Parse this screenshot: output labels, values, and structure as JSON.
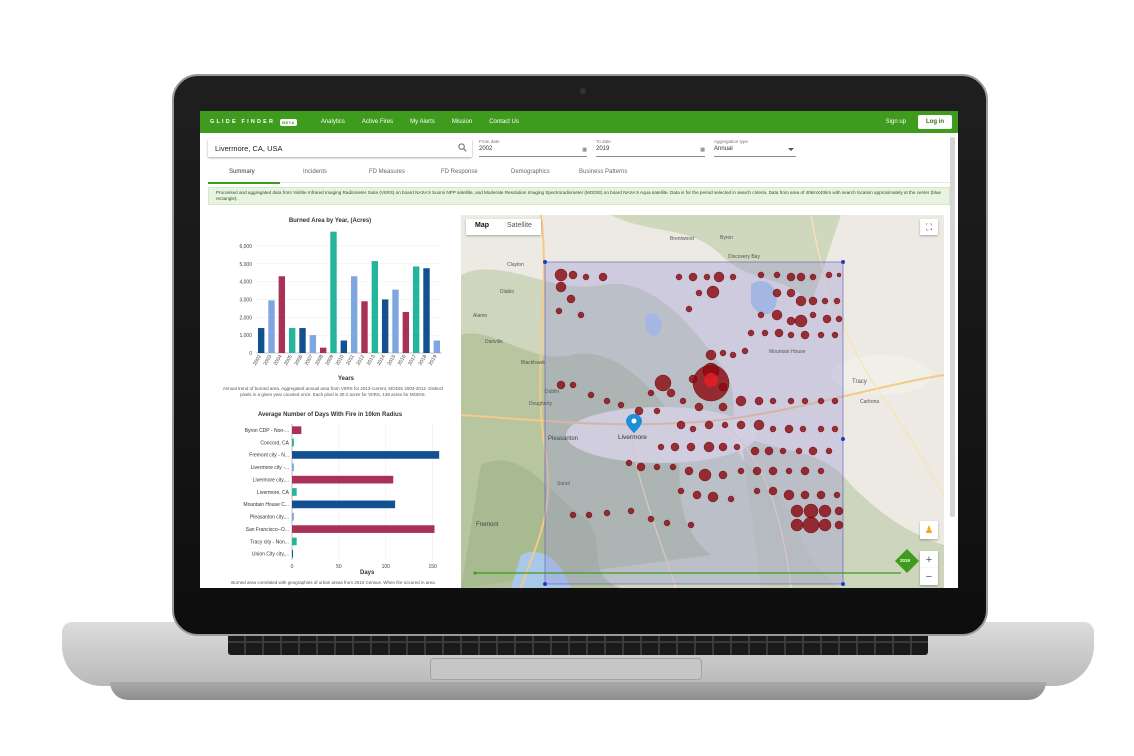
{
  "app": {
    "brand": "GLIDE FINDER",
    "badge": "BETA",
    "nav": [
      "Analytics",
      "Active Fires",
      "My Alerts",
      "Mission",
      "Contact Us"
    ],
    "signup": "Sign up",
    "login": "Log in"
  },
  "search": {
    "value": "Livermore, CA, USA"
  },
  "filters": {
    "from_label": "From date",
    "from_value": "2002",
    "to_label": "To date",
    "to_value": "2019",
    "agg_label": "Aggregation type",
    "agg_value": "Annual"
  },
  "tabs": [
    "Summary",
    "Incidents",
    "FD Measures",
    "FD Response",
    "Demographics",
    "Business Patterns"
  ],
  "info_text": "Processed and aggregated data from Visible Infrared Imaging Radiometer Suite (VIIRS) on board NASA's Suomi NPP satellite, and Moderate Resolution Imaging Spectroradiometer (MODIS) on board NASA's Aqua satellite. Data is for the period selected in search criteria. Data from area of 40kmX40km with search location approximately at the center (blue rectangle).",
  "colors": {
    "brand": "#3f9b1e",
    "teal": "#24b59a",
    "maroon": "#a83155",
    "blue": "#13508f",
    "light_blue": "#7fa6e0",
    "fire": "#8b0a10"
  },
  "chart_data": [
    {
      "type": "bar",
      "title": "Burned Area by Year, (Acres)",
      "xlabel": "Years",
      "ylabel": "",
      "ylim": [
        0,
        6500
      ],
      "yticks": [
        "0",
        "1,000",
        "2,000",
        "3,000",
        "4,000",
        "5,000",
        "6,000"
      ],
      "categories": [
        "2002",
        "2003",
        "2004",
        "2005",
        "2006",
        "2007",
        "2008",
        "2009",
        "2010",
        "2011",
        "2012",
        "2013",
        "2014",
        "2015",
        "2016",
        "2017",
        "2018",
        "2019"
      ],
      "values": [
        1400,
        2950,
        4300,
        1400,
        1400,
        1000,
        300,
        6800,
        700,
        4300,
        2900,
        5150,
        3000,
        3550,
        2300,
        4850,
        4750,
        700
      ],
      "bar_colors": [
        "blue",
        "light_blue",
        "maroon",
        "teal",
        "blue",
        "light_blue",
        "maroon",
        "teal",
        "blue",
        "light_blue",
        "maroon",
        "teal",
        "blue",
        "light_blue",
        "maroon",
        "teal",
        "blue",
        "light_blue"
      ],
      "caption": "Annual trend of burned area. Aggregated annual area from VIIRS for 2013-current, MODIS 2003-2012. Distinct pixels in a given year counted once. Each pixel is 30.2 acres for VIIRS, 139 acres for MODIS."
    },
    {
      "type": "bar",
      "orientation": "horizontal",
      "title": "Average Number of Days With Fire in 10km Radius",
      "xlabel": "Days",
      "ylabel": "",
      "xlim": [
        0,
        160
      ],
      "xticks": [
        "0",
        "50",
        "100",
        "150"
      ],
      "categories": [
        "Byron CDP - Non-...",
        "Concord, CA",
        "Fremont city - N...",
        "Livermore city -...",
        "Livermore city,...",
        "Livermore, CA",
        "Mountain House C...",
        "Pleasanton city,...",
        "San Francisco--O...",
        "Tracy city - Non...",
        "Union City city,..."
      ],
      "values": [
        10,
        2,
        157,
        2,
        108,
        5,
        110,
        2,
        152,
        5,
        1
      ],
      "bar_colors": [
        "maroon",
        "teal",
        "blue",
        "light_blue",
        "maroon",
        "teal",
        "blue",
        "light_blue",
        "maroon",
        "teal",
        "blue"
      ],
      "caption": "Burned area correlated with geographies of urban areas from 2010 Census. When fire occured in area"
    }
  ],
  "map": {
    "type_map": "Map",
    "type_satellite": "Satellite",
    "slider_value": "2019",
    "zoom_in": "+",
    "zoom_out": "−",
    "place_labels": [
      "Brentwood",
      "Discovery Bay",
      "Byron",
      "Mountain House",
      "Tracy",
      "Carbona",
      "Livermore",
      "Pleasanton",
      "Dublin",
      "Dougherty",
      "Fremont",
      "Clayton",
      "Diablo",
      "Alamo",
      "Danville",
      "Blackhawk",
      "Sunol"
    ]
  }
}
